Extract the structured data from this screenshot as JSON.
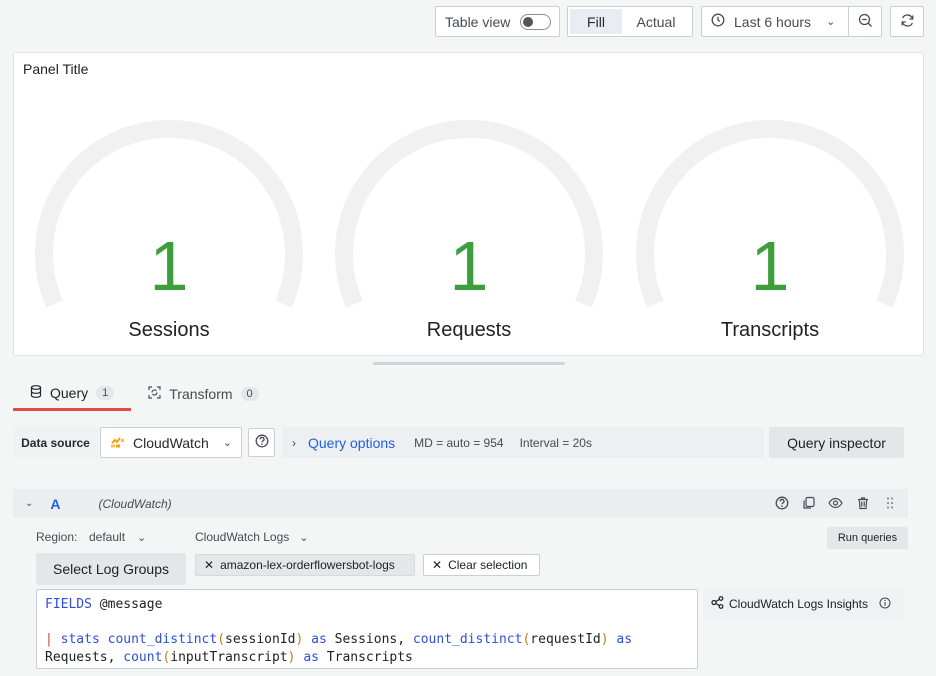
{
  "toolbar": {
    "table_view_label": "Table view",
    "table_view_on": false,
    "fill_label": "Fill",
    "actual_label": "Actual",
    "time_range_label": "Last 6 hours"
  },
  "panel": {
    "title": "Panel Title",
    "gauges": [
      {
        "value": "1",
        "label": "Sessions"
      },
      {
        "value": "1",
        "label": "Requests"
      },
      {
        "value": "1",
        "label": "Transcripts"
      }
    ],
    "gauge_color": "#3e9e3e"
  },
  "tabs": [
    {
      "label": "Query",
      "count": "1"
    },
    {
      "label": "Transform",
      "count": "0"
    }
  ],
  "datasource": {
    "label": "Data source",
    "selected": "CloudWatch",
    "query_options_label": "Query options",
    "md": "MD = auto = 954",
    "interval": "Interval = 20s",
    "query_inspector_label": "Query inspector"
  },
  "query": {
    "ref_id": "A",
    "datasource_name": "(CloudWatch)",
    "region_label": "Region:",
    "region_value": "default",
    "mode_value": "CloudWatch Logs",
    "run_label": "Run queries",
    "select_log_groups_label": "Select Log Groups",
    "log_group": "amazon-lex-orderflowersbot-logs",
    "clear_selection_label": "Clear selection",
    "insights_label": "CloudWatch Logs Insights",
    "code": {
      "l1_kw": "FIELDS",
      "l1_rest": " @message",
      "l3_pipe": "|",
      "l3_stats": "stats",
      "l3_fn1": "count_distinct",
      "l3_arg1": "sessionId",
      "l3_as1": "as",
      "l3_name1": " Sessions, ",
      "l3_fn2": "count_distinct",
      "l3_arg2": "requestId",
      "l3_as2": "as",
      "l4_name2": "Requests, ",
      "l4_fn3": "count",
      "l4_arg3": "inputTranscript",
      "l4_as3": "as",
      "l4_name3": " Transcripts"
    }
  },
  "accent_colors": {
    "link": "#1f62e0",
    "tab_active": "#e24d42"
  }
}
